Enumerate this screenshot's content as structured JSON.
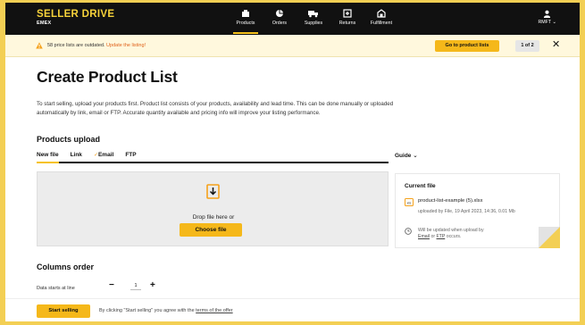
{
  "brand": {
    "title": "SELLER DRIVE",
    "subtitle": "EMEX"
  },
  "nav": [
    {
      "label": "Products",
      "icon": "products-icon",
      "active": true
    },
    {
      "label": "Orders",
      "icon": "orders-icon",
      "active": false
    },
    {
      "label": "Supplies",
      "icon": "truck-icon",
      "active": false
    },
    {
      "label": "Returns",
      "icon": "returns-icon",
      "active": false
    },
    {
      "label": "Fulfillment",
      "icon": "warehouse-icon",
      "active": false
    }
  ],
  "user": {
    "label": "RMFT",
    "icon": "user-icon"
  },
  "banner": {
    "message": "58 price lists are outdated.",
    "link": "Update the listing!",
    "button": "Go to product lists",
    "pager": "1 of 2",
    "close": "✕"
  },
  "page_title": "Create Product List",
  "intro": "To start selling, upload your products first. Product list consists of your products, availability and lead time. This can be done manually or uploaded automatically by link, email or FTP. Accurate quantity available and pricing info will improve your listing performance.",
  "upload": {
    "heading": "Products upload",
    "tabs": [
      {
        "label": "New file",
        "active": true,
        "checked": false
      },
      {
        "label": "Link",
        "active": false,
        "checked": false
      },
      {
        "label": "Email",
        "active": false,
        "checked": true
      },
      {
        "label": "FTP",
        "active": false,
        "checked": false
      }
    ],
    "guide": "Guide",
    "drop_text": "Drop file here or",
    "choose_button": "Choose file"
  },
  "current_file": {
    "title": "Current file",
    "file_name": "product-list-example (5).xlsx",
    "uploaded": "uploaded by File, 19 April 2023, 14:36, 0.01 Mb",
    "note_prefix": "Will be updated when upload by",
    "note_email": "Email",
    "note_or": "or",
    "note_ftp": "FTP",
    "note_suffix": "occurs."
  },
  "columns": {
    "heading": "Columns order",
    "data_starts_label": "Data starts at line",
    "value": "1"
  },
  "footer": {
    "start_button": "Start selling",
    "terms_prefix": "By clicking \"Start selling\" you agree with the",
    "terms_link": "terms of the offer"
  },
  "colors": {
    "accent": "#f5b81a",
    "topbar": "#111111",
    "brand": "#f6d23a",
    "link": "#e0621b"
  }
}
